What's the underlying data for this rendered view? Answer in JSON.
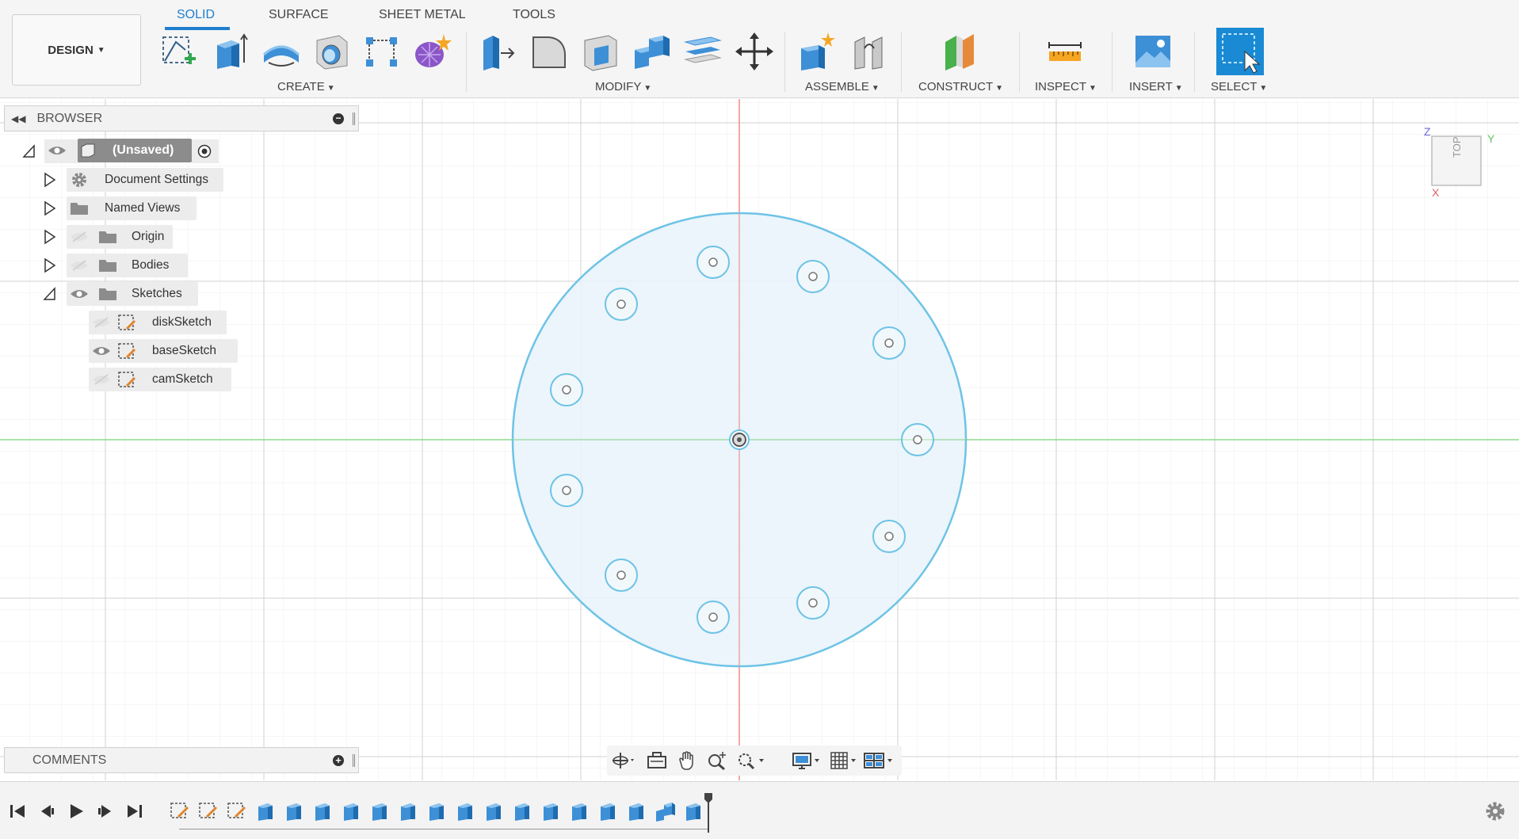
{
  "workspace": {
    "label": "DESIGN"
  },
  "tabs": [
    {
      "label": "SOLID",
      "active": true
    },
    {
      "label": "SURFACE",
      "active": false
    },
    {
      "label": "SHEET METAL",
      "active": false
    },
    {
      "label": "TOOLS",
      "active": false
    }
  ],
  "toolbar_groups": [
    {
      "label": "CREATE",
      "tools": [
        "create-sketch-icon",
        "extrude-icon",
        "revolve-icon",
        "hole-icon",
        "pattern-icon",
        "create-form-icon"
      ]
    },
    {
      "label": "MODIFY",
      "tools": [
        "press-pull-icon",
        "fillet-icon",
        "shell-icon",
        "combine-icon",
        "offset-face-icon",
        "move-icon"
      ]
    },
    {
      "label": "ASSEMBLE",
      "tools": [
        "new-component-icon",
        "joint-icon"
      ]
    },
    {
      "label": "CONSTRUCT",
      "tools": [
        "plane-icon"
      ]
    },
    {
      "label": "INSPECT",
      "tools": [
        "measure-icon"
      ]
    },
    {
      "label": "INSERT",
      "tools": [
        "insert-image-icon"
      ]
    },
    {
      "label": "SELECT",
      "tools": [
        "select-icon"
      ]
    }
  ],
  "browser": {
    "title": "BROWSER",
    "root": {
      "label": "(Unsaved)"
    },
    "items": [
      {
        "label": "Document Settings",
        "icon": "gear-icon",
        "visible": null
      },
      {
        "label": "Named Views",
        "icon": "folder-icon",
        "visible": null
      },
      {
        "label": "Origin",
        "icon": "folder-icon",
        "visible": false
      },
      {
        "label": "Bodies",
        "icon": "folder-icon",
        "visible": false
      },
      {
        "label": "Sketches",
        "icon": "folder-icon",
        "visible": true,
        "expanded": true
      }
    ],
    "sketches": [
      {
        "label": "diskSketch",
        "visible": false
      },
      {
        "label": "baseSketch",
        "visible": true
      },
      {
        "label": "camSketch",
        "visible": false
      }
    ]
  },
  "comments": {
    "title": "COMMENTS"
  },
  "viewcube": {
    "face": "TOP",
    "axes": [
      "Z",
      "Y",
      "X"
    ]
  },
  "colors": {
    "accent": "#1f7fcf",
    "sketch_line": "#6ec3e6",
    "sketch_fill": "#e8f3fa",
    "x_axis": "#f08c8c",
    "y_axis": "#8fd88f"
  },
  "timeline": {
    "controls": [
      "skip-start-icon",
      "step-back-icon",
      "play-icon",
      "step-forward-icon",
      "skip-end-icon"
    ],
    "features": [
      "sketch",
      "sketch",
      "sketch",
      "body",
      "body",
      "body",
      "body",
      "body",
      "body",
      "body",
      "body",
      "body",
      "body",
      "body",
      "body",
      "body",
      "body",
      "combine",
      "body"
    ]
  }
}
